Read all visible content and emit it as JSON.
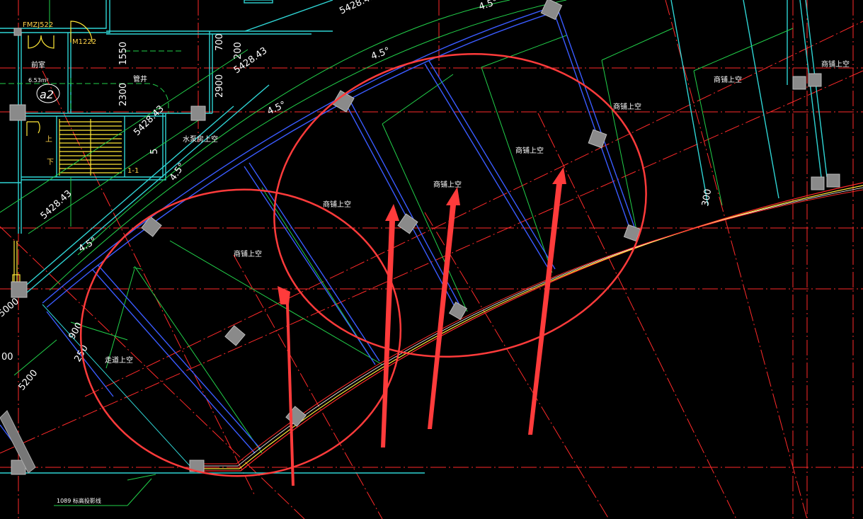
{
  "drawing": {
    "labels": {
      "shop_void": "商铺上空",
      "corridor_void": "走道上空",
      "pump_room_void": "水泵房上空",
      "front_room": "前室",
      "pipe_shaft": "管井",
      "door_fm": "FMZJ522",
      "door_m": "M1222",
      "area_tag": "a2",
      "area_value": "6.53m²",
      "section_tag": "1-1",
      "stair_up": "上",
      "stair_down": "下",
      "elevation_note": "1089 标高投影线"
    },
    "dimensions": {
      "radius": "5428.43",
      "angle": "4.5°",
      "d1550": "1550",
      "d2300": "2300",
      "d700": "700",
      "d200": "200",
      "d2900": "2900",
      "d300": "300",
      "d900": "900",
      "d250": "250",
      "d5200": "5200",
      "d5000": "5000",
      "d00": "00",
      "d5": "5"
    }
  },
  "colors": {
    "background": "#000000",
    "axis_red": "#ff2a2a",
    "wall_cyan": "#2fd4d4",
    "beam_blue": "#3a5bff",
    "green": "#22d04a",
    "yellow": "#ffe838",
    "markup_red": "#ff3b3b",
    "column_gray": "#8a8a8a"
  }
}
